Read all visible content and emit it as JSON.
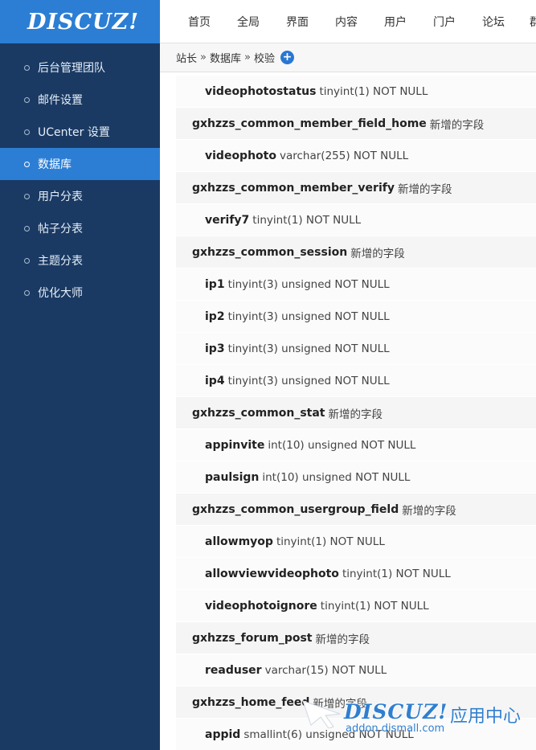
{
  "logo": {
    "text": "DISCUZ!"
  },
  "sidebar": {
    "items": [
      {
        "label": "后台管理团队",
        "active": false
      },
      {
        "label": "邮件设置",
        "active": false
      },
      {
        "label": "UCenter 设置",
        "active": false
      },
      {
        "label": "数据库",
        "active": true
      },
      {
        "label": "用户分表",
        "active": false
      },
      {
        "label": "帖子分表",
        "active": false
      },
      {
        "label": "主题分表",
        "active": false
      },
      {
        "label": "优化大师",
        "active": false
      }
    ]
  },
  "topnav": {
    "items": [
      "首页",
      "全局",
      "界面",
      "内容",
      "用户",
      "门户",
      "论坛",
      "群"
    ]
  },
  "breadcrumb": {
    "items": [
      "站长",
      "数据库",
      "校验"
    ],
    "separator": "»",
    "add_icon": "plus-icon"
  },
  "rows": [
    {
      "kind": "field",
      "name": "videophotostatus",
      "desc": "tinyint(1) NOT NULL"
    },
    {
      "kind": "table",
      "name": "gxhzzs_common_member_field_home",
      "desc": "新增的字段"
    },
    {
      "kind": "field",
      "name": "videophoto",
      "desc": "varchar(255) NOT NULL"
    },
    {
      "kind": "table",
      "name": "gxhzzs_common_member_verify",
      "desc": "新增的字段"
    },
    {
      "kind": "field",
      "name": "verify7",
      "desc": "tinyint(1) NOT NULL"
    },
    {
      "kind": "table",
      "name": "gxhzzs_common_session",
      "desc": "新增的字段"
    },
    {
      "kind": "field",
      "name": "ip1",
      "desc": "tinyint(3) unsigned NOT NULL"
    },
    {
      "kind": "field",
      "name": "ip2",
      "desc": "tinyint(3) unsigned NOT NULL"
    },
    {
      "kind": "field",
      "name": "ip3",
      "desc": "tinyint(3) unsigned NOT NULL"
    },
    {
      "kind": "field",
      "name": "ip4",
      "desc": "tinyint(3) unsigned NOT NULL"
    },
    {
      "kind": "table",
      "name": "gxhzzs_common_stat",
      "desc": "新增的字段"
    },
    {
      "kind": "field",
      "name": "appinvite",
      "desc": "int(10) unsigned NOT NULL"
    },
    {
      "kind": "field",
      "name": "paulsign",
      "desc": "int(10) unsigned NOT NULL"
    },
    {
      "kind": "table",
      "name": "gxhzzs_common_usergroup_field",
      "desc": "新增的字段"
    },
    {
      "kind": "field",
      "name": "allowmyop",
      "desc": "tinyint(1) NOT NULL"
    },
    {
      "kind": "field",
      "name": "allowviewvideophoto",
      "desc": "tinyint(1) NOT NULL"
    },
    {
      "kind": "field",
      "name": "videophotoignore",
      "desc": "tinyint(1) NOT NULL"
    },
    {
      "kind": "table",
      "name": "gxhzzs_forum_post",
      "desc": "新增的字段"
    },
    {
      "kind": "field",
      "name": "readuser",
      "desc": "varchar(15) NOT NULL"
    },
    {
      "kind": "table",
      "name": "gxhzzs_home_feed",
      "desc": "新增的字段"
    },
    {
      "kind": "field",
      "name": "appid",
      "desc": "smallint(6) unsigned NOT NULL"
    }
  ],
  "watermark": {
    "logo": "DISCUZ!",
    "text": "应用中心",
    "url": "addon.dismall.com"
  },
  "colors": {
    "sidebar_bg": "#1a3a63",
    "accent": "#2b7ed4",
    "watermark": "#2f7fd0"
  }
}
